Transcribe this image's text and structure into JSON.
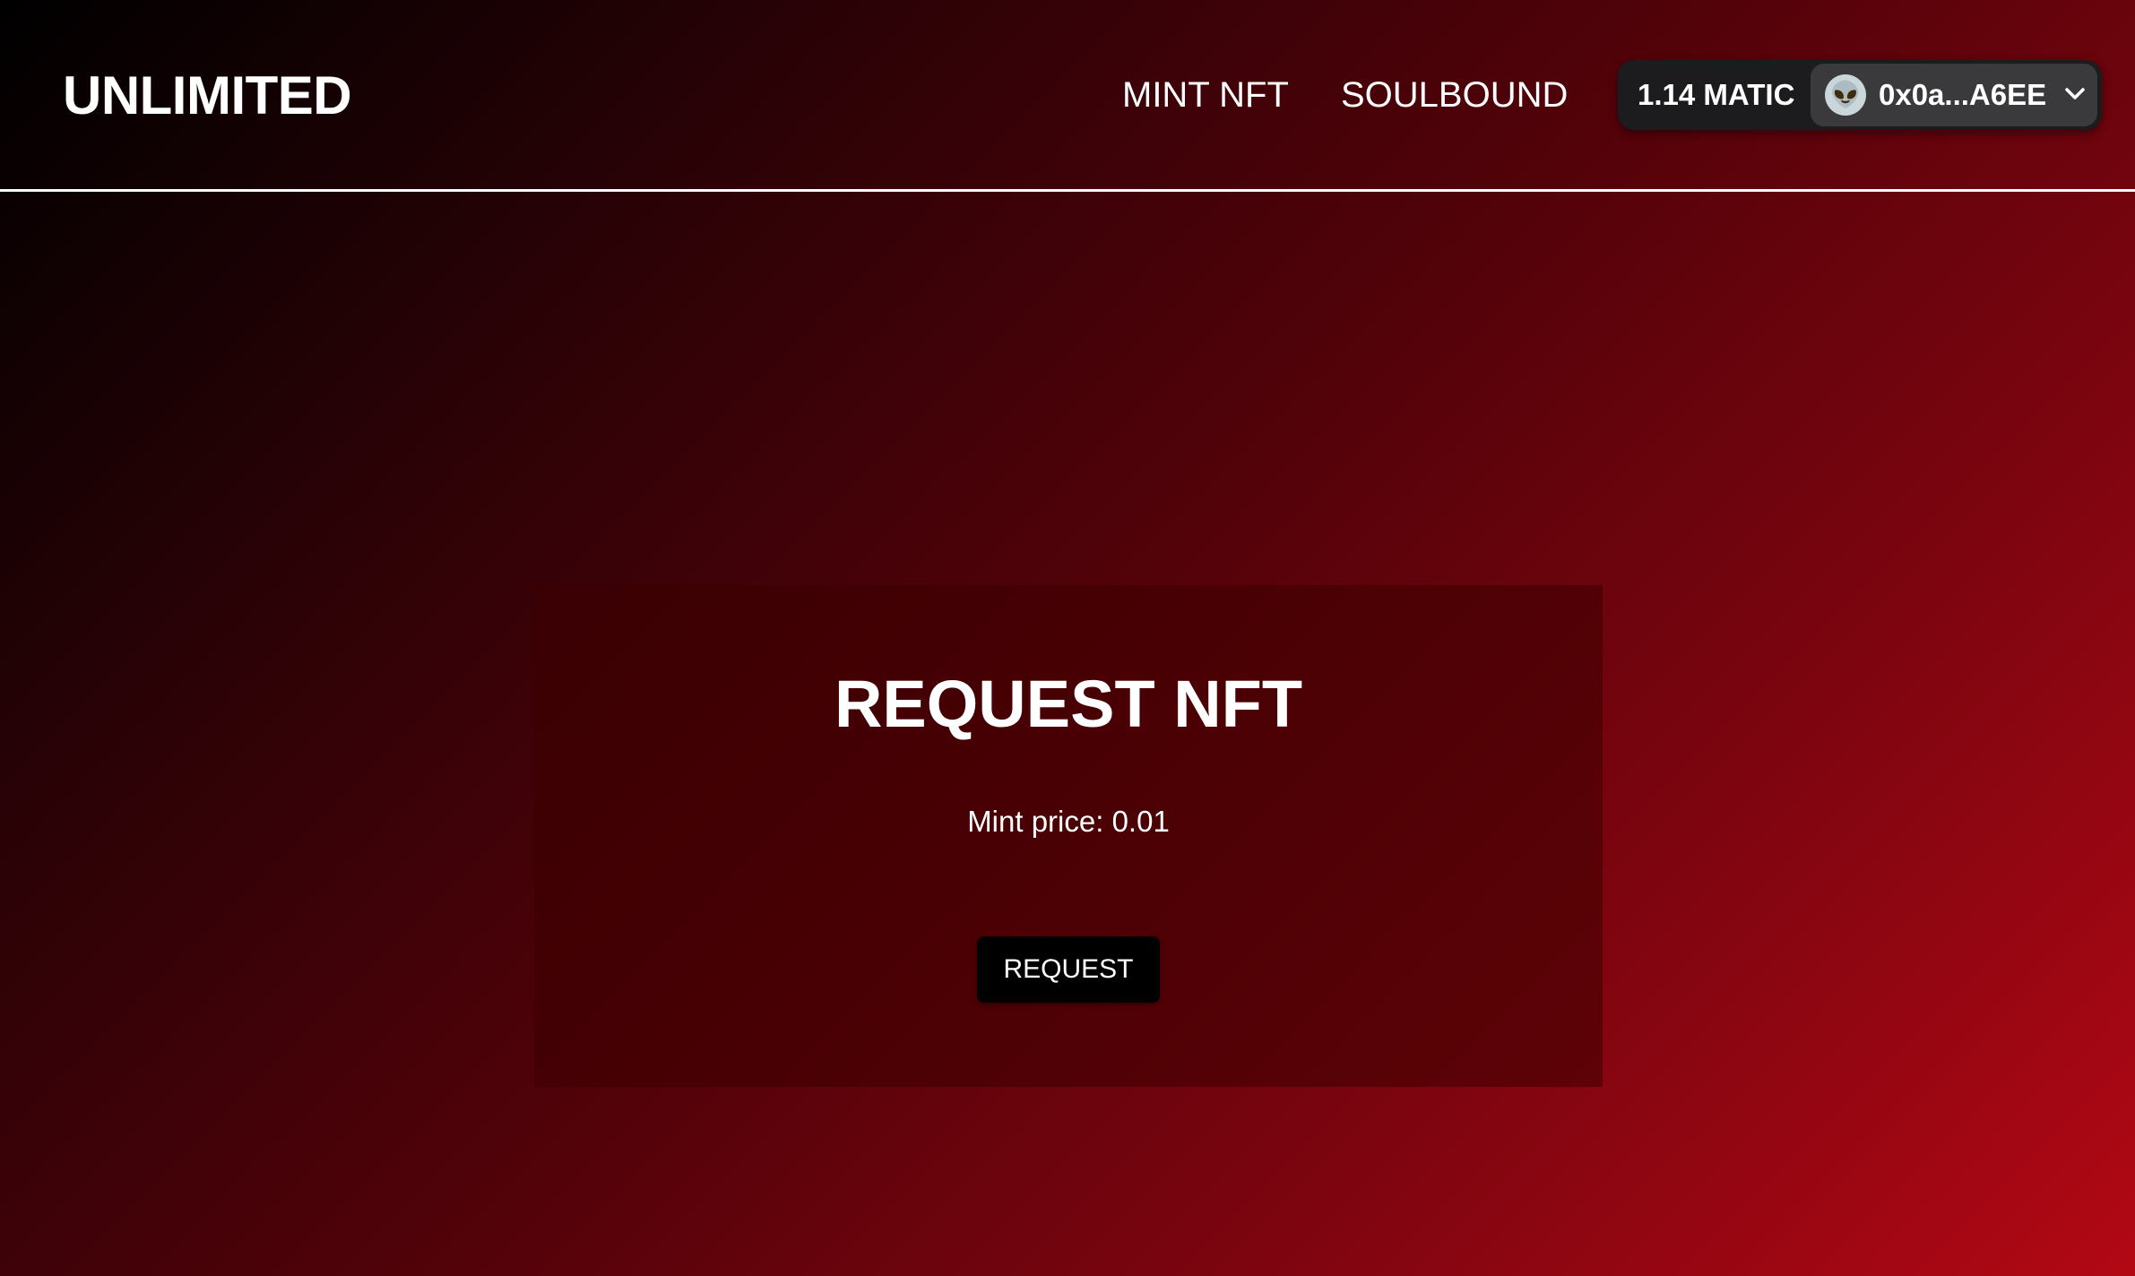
{
  "header": {
    "brand": "UNLIMITED",
    "nav": [
      {
        "label": "MINT NFT"
      },
      {
        "label": "SOULBOUND"
      }
    ],
    "wallet": {
      "balance": "1.14 MATIC",
      "address": "0x0a...A6EE",
      "avatar_emoji": "👽",
      "avatar_icon": "alien-avatar-icon",
      "dropdown_icon": "chevron-down-icon"
    }
  },
  "main": {
    "card": {
      "title": "REQUEST NFT",
      "price_label": "Mint price:",
      "price_value": "0.01",
      "button_label": "REQUEST"
    }
  },
  "colors": {
    "gradient_start": "#000000",
    "gradient_end": "#b20814",
    "wallet_bg": "#1c1c1e",
    "account_bg": "#3a3a3c",
    "button_bg": "#000000"
  }
}
